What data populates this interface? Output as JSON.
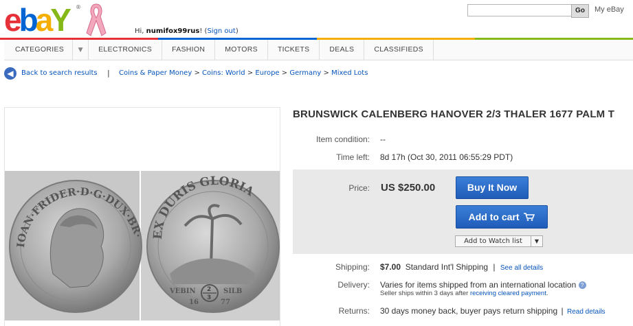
{
  "header": {
    "logo_letters": [
      "e",
      "b",
      "a",
      "Y"
    ],
    "trademark": "®",
    "greeting_prefix": "Hi, ",
    "username": "numifox99rus",
    "greeting_suffix": "! (",
    "sign_out": "Sign out",
    "greeting_end": ")",
    "search_placeholder": "",
    "go_label": "Go",
    "my_ebay": "My eBay",
    "brand_colors": [
      "#e53238",
      "#0064d2",
      "#f5af02",
      "#86b817"
    ]
  },
  "nav": {
    "categories": "CATEGORIES",
    "items": [
      "ELECTRONICS",
      "FASHION",
      "MOTORS",
      "TICKETS",
      "DEALS",
      "CLASSIFIEDS"
    ]
  },
  "breadcrumb": {
    "back_label": "Back to search results",
    "separator": "|",
    "path": [
      "Coins & Paper Money",
      "Coins: World",
      "Europe",
      "Germany",
      "Mixed Lots"
    ],
    "arrow": ">"
  },
  "item": {
    "title": "BRUNSWICK CALENBERG HANOVER 2/3 THALER 1677 PALM T",
    "condition_label": "Item condition:",
    "condition_value": "--",
    "time_left_label": "Time left:",
    "time_left_value": "8d 17h (Oct 30, 2011 06:55:29 PDT)",
    "price_label": "Price:",
    "price_value": "US $250.00",
    "buy_now": "Buy It Now",
    "add_to_cart": "Add to cart",
    "add_to_watch": "Add to Watch list",
    "shipping_label": "Shipping:",
    "shipping_cost": "$7.00",
    "shipping_method": "Standard Int'l Shipping",
    "shipping_sep": "|",
    "see_all_details": "See all details",
    "delivery_label": "Delivery:",
    "delivery_value": "Varies for items shipped from an international location",
    "delivery_note_prefix": "Seller ships within 3 days after ",
    "delivery_note_link": "receiving cleared payment",
    "delivery_note_suffix": ".",
    "returns_label": "Returns:",
    "returns_value": "30 days money back, buyer pays return shipping",
    "returns_sep": "|",
    "read_details": "Read details"
  },
  "coin_obverse_legend": "IOAN·FRIDER·D·G·DUX·BR·E·L",
  "coin_reverse_legend": "EX DURIS GLORIA",
  "coin_reverse_bottom": [
    "VEBIN",
    "SILB",
    "16",
    "77"
  ],
  "coin_denomination": [
    "2",
    "3"
  ]
}
